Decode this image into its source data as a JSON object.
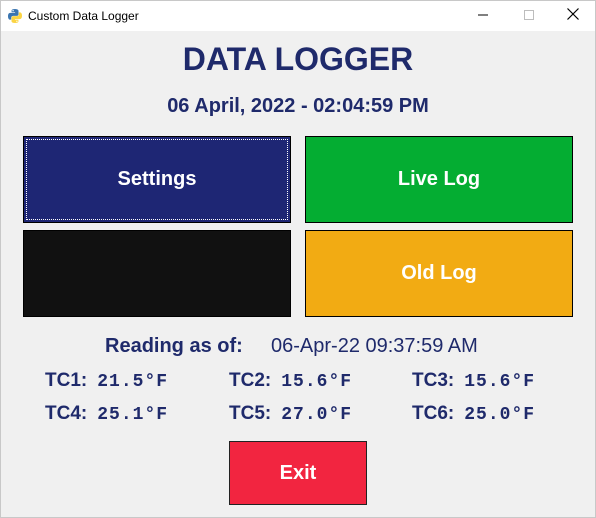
{
  "window": {
    "title": "Custom Data Logger",
    "icons": {
      "app": "python-icon",
      "minimize": "minimize-icon",
      "maximize": "maximize-icon",
      "close": "close-icon"
    }
  },
  "header": {
    "title": "DATA LOGGER",
    "datetime": "06 April, 2022 - 02:04:59 PM"
  },
  "buttons": {
    "settings": "Settings",
    "live_log": "Live Log",
    "blank": "",
    "old_log": "Old Log",
    "exit": "Exit"
  },
  "colors": {
    "title_text": "#1f2a6b",
    "settings": "#1e2674",
    "live_log": "#04ad32",
    "blank": "#111111",
    "old_log": "#f2ab13",
    "exit": "#f22540"
  },
  "reading": {
    "label": "Reading as of:",
    "timestamp": "06-Apr-22 09:37:59 AM"
  },
  "thermocouples": [
    {
      "label": "TC1:",
      "value": "21.5°F"
    },
    {
      "label": "TC2:",
      "value": "15.6°F"
    },
    {
      "label": "TC3:",
      "value": "15.6°F"
    },
    {
      "label": "TC4:",
      "value": "25.1°F"
    },
    {
      "label": "TC5:",
      "value": "27.0°F"
    },
    {
      "label": "TC6:",
      "value": "25.0°F"
    }
  ]
}
